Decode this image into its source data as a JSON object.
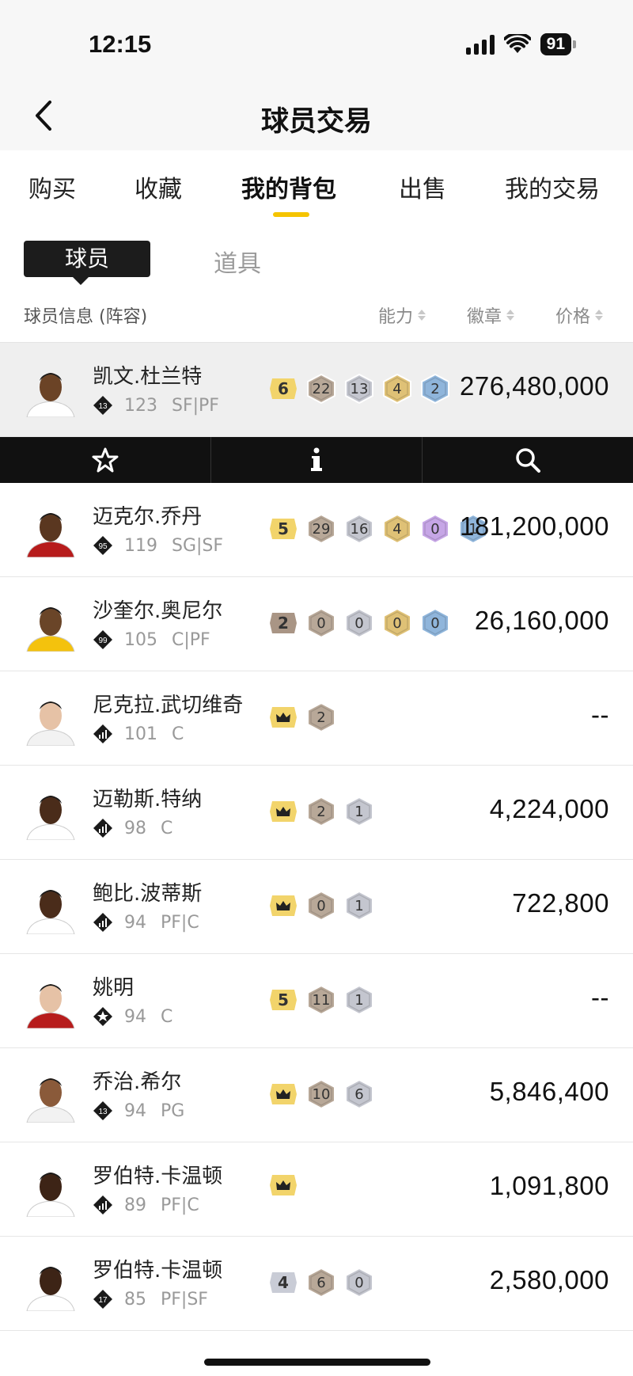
{
  "status": {
    "time": "12:15",
    "battery": "91"
  },
  "nav": {
    "title": "球员交易"
  },
  "tabs": [
    {
      "label": "购买",
      "active": false
    },
    {
      "label": "收藏",
      "active": false
    },
    {
      "label": "我的背包",
      "active": true
    },
    {
      "label": "出售",
      "active": false
    },
    {
      "label": "我的交易",
      "active": false
    }
  ],
  "subtabs": {
    "active": "球员",
    "inactive": "道具"
  },
  "columns": {
    "info": "球员信息 (阵容)",
    "ability": "能力",
    "badge": "徽章",
    "price": "价格"
  },
  "colors": {
    "accent": "#f5c400",
    "bronze": "#b8a898",
    "silver": "#c4c6cf",
    "gold": "#dfc176",
    "purple": "#c6a6e6",
    "blue": "#8fb5db"
  },
  "players": [
    {
      "name": "凯文.杜兰特",
      "rating": "123",
      "position": "SF|PF",
      "level": "13",
      "rank": "6",
      "badges": [
        [
          "bronze",
          "22"
        ],
        [
          "silver",
          "13"
        ],
        [
          "gold",
          "4"
        ],
        [
          "blue",
          "2"
        ]
      ],
      "price": "276,480,000",
      "selected": true
    },
    {
      "name": "迈克尔.乔丹",
      "rating": "119",
      "position": "SG|SF",
      "level": "95",
      "rank": "5",
      "badges": [
        [
          "bronze",
          "29"
        ],
        [
          "silver",
          "16"
        ],
        [
          "gold",
          "4"
        ],
        [
          "purple",
          "0"
        ],
        [
          "blue",
          "1"
        ]
      ],
      "price": "181,200,000"
    },
    {
      "name": "沙奎尔.奥尼尔",
      "rating": "105",
      "position": "C|PF",
      "level": "99",
      "rank": "2",
      "badges": [
        [
          "bronze",
          "0"
        ],
        [
          "silver",
          "0"
        ],
        [
          "gold",
          "0"
        ],
        [
          "blue",
          "0"
        ]
      ],
      "price": "26,160,000"
    },
    {
      "name": "尼克拉.武切维奇",
      "rating": "101",
      "position": "C",
      "level": "",
      "rank": "crown",
      "badges": [
        [
          "bronze",
          "2"
        ]
      ],
      "price": "--"
    },
    {
      "name": "迈勒斯.特纳",
      "rating": "98",
      "position": "C",
      "level": "",
      "rank": "crown",
      "badges": [
        [
          "bronze",
          "2"
        ],
        [
          "silver",
          "1"
        ]
      ],
      "price": "4,224,000"
    },
    {
      "name": "鲍比.波蒂斯",
      "rating": "94",
      "position": "PF|C",
      "level": "",
      "rank": "crown",
      "badges": [
        [
          "bronze",
          "0"
        ],
        [
          "silver",
          "1"
        ]
      ],
      "price": "722,800"
    },
    {
      "name": "姚明",
      "rating": "94",
      "position": "C",
      "level": "star",
      "rank": "5",
      "badges": [
        [
          "bronze",
          "11"
        ],
        [
          "silver",
          "1"
        ]
      ],
      "price": "--"
    },
    {
      "name": "乔治.希尔",
      "rating": "94",
      "position": "PG",
      "level": "13",
      "rank": "crown",
      "badges": [
        [
          "bronze",
          "10"
        ],
        [
          "silver",
          "6"
        ]
      ],
      "price": "5,846,400"
    },
    {
      "name": "罗伯特.卡温顿",
      "rating": "89",
      "position": "PF|C",
      "level": "",
      "rank": "crown",
      "badges": [],
      "price": "1,091,800"
    },
    {
      "name": "罗伯特.卡温顿",
      "rating": "85",
      "position": "PF|SF",
      "level": "17",
      "rank": "4",
      "badges": [
        [
          "bronze",
          "6"
        ],
        [
          "silver",
          "0"
        ]
      ],
      "price": "2,580,000"
    }
  ],
  "actions": [
    "star-icon",
    "info-icon",
    "search-icon"
  ]
}
